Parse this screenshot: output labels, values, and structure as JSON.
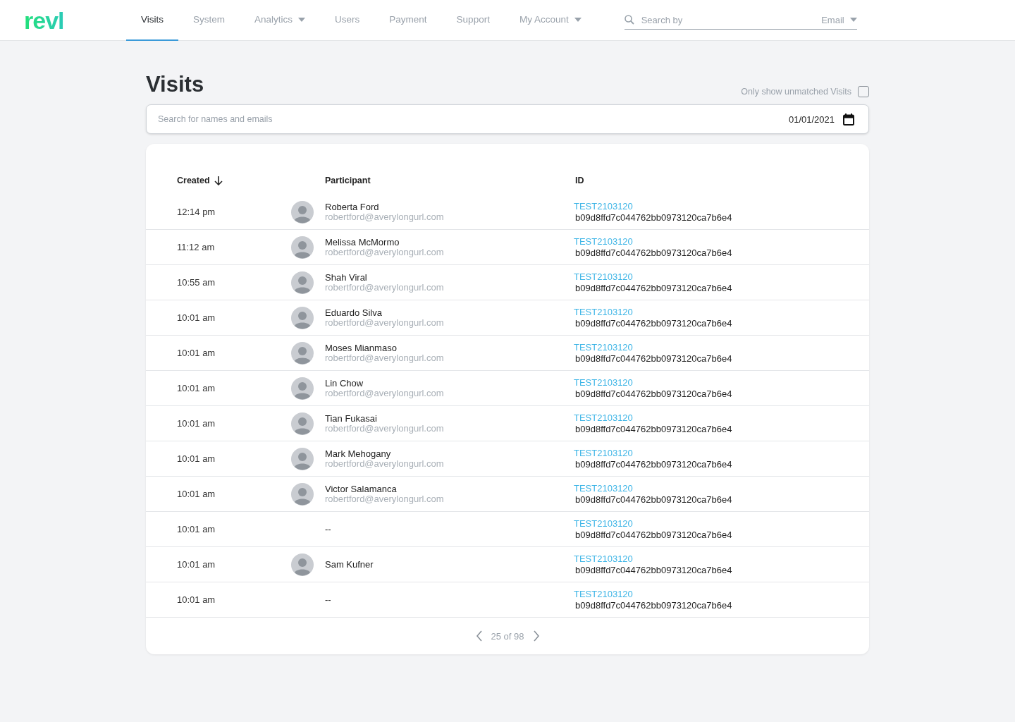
{
  "logo": "revl",
  "nav": [
    {
      "label": "Visits",
      "selected": true,
      "dropdown": false
    },
    {
      "label": "System",
      "selected": false,
      "dropdown": false
    },
    {
      "label": "Analytics",
      "selected": false,
      "dropdown": true
    },
    {
      "label": "Users",
      "selected": false,
      "dropdown": false
    },
    {
      "label": "Payment",
      "selected": false,
      "dropdown": false
    },
    {
      "label": "Support",
      "selected": false,
      "dropdown": false
    },
    {
      "label": "My Account",
      "selected": false,
      "dropdown": true
    }
  ],
  "header_search": {
    "placeholder": "Search by",
    "field": "Email"
  },
  "page_title": "Visits",
  "unmatched_filter": {
    "label": "Only show unmatched Visits",
    "checked": false
  },
  "search": {
    "placeholder": "Search for names and emails",
    "date": "01/01/2021"
  },
  "table": {
    "columns": [
      "Created",
      "Participant",
      "ID"
    ],
    "rows": [
      {
        "created": "12:14 pm",
        "avatar": true,
        "name": "Roberta Ford",
        "email": "robertford@averylongurl.com",
        "test_id": "TEST2103120",
        "hash": "b09d8ffd7c044762bb0973120ca7b6e4"
      },
      {
        "created": "11:12 am",
        "avatar": true,
        "name": "Melissa McMormo",
        "email": "robertford@averylongurl.com",
        "test_id": "TEST2103120",
        "hash": "b09d8ffd7c044762bb0973120ca7b6e4"
      },
      {
        "created": "10:55 am",
        "avatar": true,
        "name": "Shah Viral",
        "email": "robertford@averylongurl.com",
        "test_id": "TEST2103120",
        "hash": "b09d8ffd7c044762bb0973120ca7b6e4"
      },
      {
        "created": "10:01 am",
        "avatar": true,
        "name": "Eduardo Silva",
        "email": "robertford@averylongurl.com",
        "test_id": "TEST2103120",
        "hash": "b09d8ffd7c044762bb0973120ca7b6e4"
      },
      {
        "created": "10:01 am",
        "avatar": true,
        "name": "Moses Mianmaso",
        "email": "robertford@averylongurl.com",
        "test_id": "TEST2103120",
        "hash": "b09d8ffd7c044762bb0973120ca7b6e4"
      },
      {
        "created": "10:01 am",
        "avatar": true,
        "name": "Lin Chow",
        "email": "robertford@averylongurl.com",
        "test_id": "TEST2103120",
        "hash": "b09d8ffd7c044762bb0973120ca7b6e4"
      },
      {
        "created": "10:01 am",
        "avatar": true,
        "name": "Tian Fukasai",
        "email": "robertford@averylongurl.com",
        "test_id": "TEST2103120",
        "hash": "b09d8ffd7c044762bb0973120ca7b6e4"
      },
      {
        "created": "10:01 am",
        "avatar": true,
        "name": "Mark Mehogany",
        "email": "robertford@averylongurl.com",
        "test_id": "TEST2103120",
        "hash": "b09d8ffd7c044762bb0973120ca7b6e4"
      },
      {
        "created": "10:01 am",
        "avatar": true,
        "name": "Victor Salamanca",
        "email": "robertford@averylongurl.com",
        "test_id": "TEST2103120",
        "hash": "b09d8ffd7c044762bb0973120ca7b6e4"
      },
      {
        "created": "10:01 am",
        "avatar": false,
        "name": "--",
        "test_id": "TEST2103120",
        "hash": "b09d8ffd7c044762bb0973120ca7b6e4"
      },
      {
        "created": "10:01 am",
        "avatar": true,
        "name": "Sam Kufner",
        "test_id": "TEST2103120",
        "hash": "b09d8ffd7c044762bb0973120ca7b6e4"
      },
      {
        "created": "10:01 am",
        "avatar": false,
        "name": "--",
        "test_id": "TEST2103120",
        "hash": "b09d8ffd7c044762bb0973120ca7b6e4"
      }
    ]
  },
  "pagination": "25 of 98"
}
